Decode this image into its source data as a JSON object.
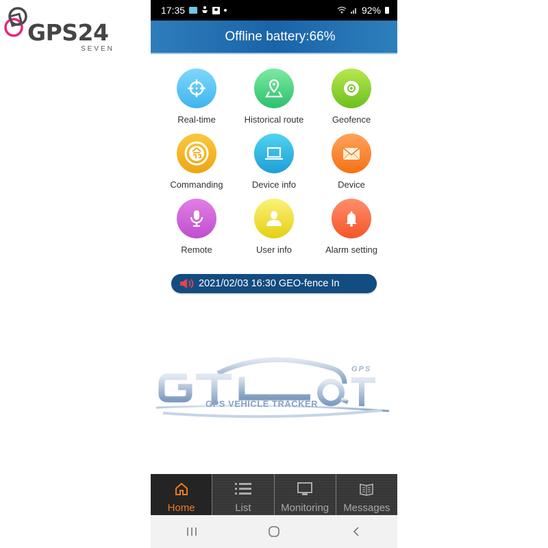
{
  "brand": {
    "name": "GPS24",
    "tagline": "SEVEN",
    "accent_color": "#e8267a"
  },
  "status_bar": {
    "time": "17:35",
    "battery": "92%"
  },
  "header": {
    "title": "Offline battery:66%"
  },
  "menu": {
    "items": [
      {
        "label": "Real-time",
        "icon": "crosshair-icon",
        "color_top": "#7fd8fb",
        "color_bottom": "#3fb4ee"
      },
      {
        "label": "Historical route",
        "icon": "map-pin-icon",
        "color_top": "#7de9a3",
        "color_bottom": "#2bc16c"
      },
      {
        "label": "Geofence",
        "icon": "target-icon",
        "color_top": "#b7e84f",
        "color_bottom": "#6cc01e"
      },
      {
        "label": "Commanding",
        "icon": "command-icon",
        "color_top": "#f8c83e",
        "color_bottom": "#eea614"
      },
      {
        "label": "Device info",
        "icon": "laptop-icon",
        "color_top": "#4fd3f0",
        "color_bottom": "#1e9fd6"
      },
      {
        "label": "Device",
        "icon": "envelope-icon",
        "color_top": "#ffa35a",
        "color_bottom": "#f57115"
      },
      {
        "label": "Remote",
        "icon": "microphone-icon",
        "color_top": "#e27ee4",
        "color_bottom": "#bf4fcf"
      },
      {
        "label": "User info",
        "icon": "user-icon",
        "color_top": "#fbf27a",
        "color_bottom": "#e5cf12"
      },
      {
        "label": "Alarm setting",
        "icon": "bell-icon",
        "color_top": "#ff8f6a",
        "color_bottom": "#f55429"
      }
    ]
  },
  "ticker": {
    "message": "2021/02/03 16:30 GEO-fence In",
    "icon": "speaker-icon",
    "background": "#134c80"
  },
  "app_logo": {
    "text": "GPS VEHICLE TRACKER",
    "badge": "GPS"
  },
  "tabs": [
    {
      "label": "Home",
      "icon": "home-icon",
      "active": true
    },
    {
      "label": "List",
      "icon": "list-icon",
      "active": false
    },
    {
      "label": "Monitoring",
      "icon": "monitor-icon",
      "active": false
    },
    {
      "label": "Messages",
      "icon": "book-icon",
      "active": false
    }
  ],
  "navigation": {
    "recents": "recents-icon",
    "home": "home-circle-icon",
    "back": "back-icon"
  }
}
